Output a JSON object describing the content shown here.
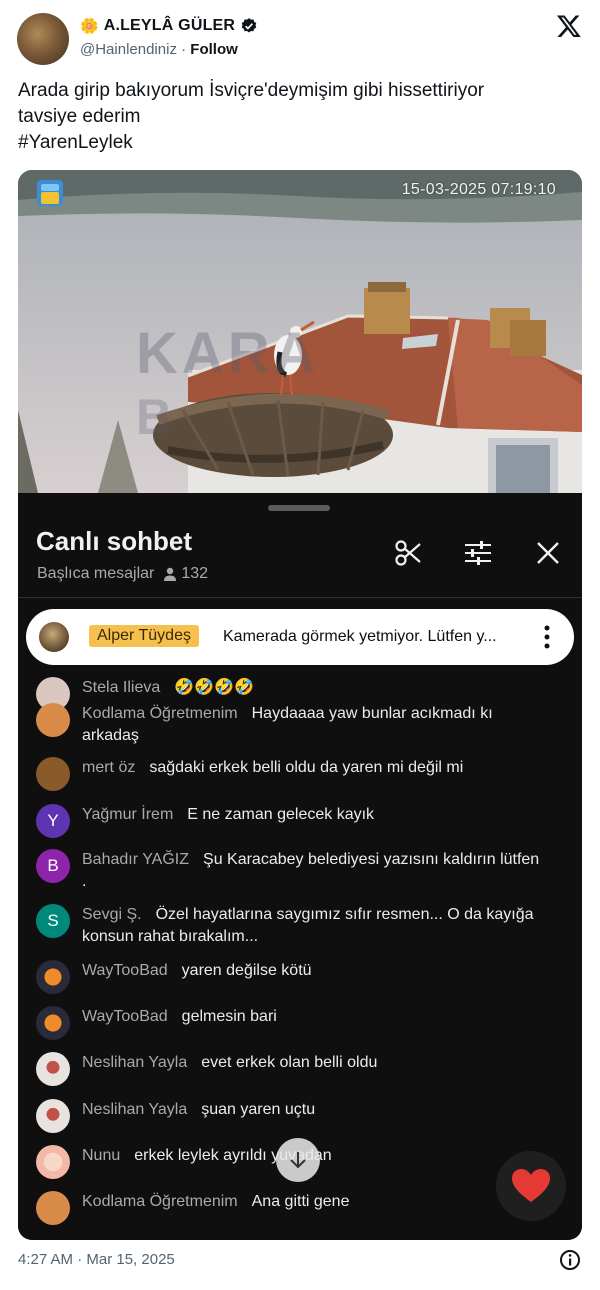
{
  "tweet": {
    "emoji": "🌼",
    "display_name": "A.LEYLÂ GÜLER",
    "handle": "@Hainlendiniz",
    "separator": " · ",
    "follow_label": "Follow",
    "text_lines": [
      "Arada girip bakıyorum İsviçre'deymişim gibi hissettiriyor",
      "tavsiye ederim",
      "#YarenLeylek"
    ],
    "footer": "4:27 AM · Mar 15, 2025"
  },
  "video": {
    "timestamp": "15-03-2025 07:19:10",
    "watermark_line1": "KARA",
    "watermark_line2": "B"
  },
  "chat": {
    "title": "Canlı sohbet",
    "filter_label": "Başlıca mesajlar",
    "viewer_count": "132",
    "pinned": {
      "author": "Alper Tüydeş",
      "message": "Kamerada görmek yetmiyor. Lütfen y..."
    },
    "messages": [
      {
        "author": "Stela Ilieva",
        "text": "🤣🤣🤣🤣",
        "avatar_letter": "",
        "avatar_color": "#d9c7c0"
      },
      {
        "author": "Kodlama Öğretmenim",
        "text": "Haydaaaa yaw bunlar acıkmadı kı arkadaş",
        "avatar_letter": "",
        "avatar_color": "#d98b4a"
      },
      {
        "author": "mert öz",
        "text": "sağdaki erkek belli oldu da yaren mi değil mi",
        "avatar_letter": "",
        "avatar_color": "#8a5a2a"
      },
      {
        "author": "Yağmur İrem",
        "text": "E ne zaman gelecek kayık",
        "avatar_letter": "Y",
        "avatar_color": "#5e35b1"
      },
      {
        "author": "Bahadır YAĞIZ",
        "text": "Şu Karacabey belediyesi yazısını kaldırın lütfen .",
        "avatar_letter": "B",
        "avatar_color": "#8e24aa"
      },
      {
        "author": "Sevgi Ş.",
        "text": "Özel hayatlarına saygımız sıfır resmen... O da kayığa konsun rahat bırakalım...",
        "avatar_letter": "S",
        "avatar_color": "#00897b"
      },
      {
        "author": "WayTooBad",
        "text": "yaren değilse kötü",
        "avatar_letter": "",
        "avatar_color": "#2a2a3a"
      },
      {
        "author": "WayTooBad",
        "text": "gelmesin bari",
        "avatar_letter": "",
        "avatar_color": "#2a2a3a"
      },
      {
        "author": "Neslihan Yayla",
        "text": "evet erkek olan belli oldu",
        "avatar_letter": "",
        "avatar_color": "#e9e3e0"
      },
      {
        "author": "Neslihan Yayla",
        "text": "şuan yaren uçtu",
        "avatar_letter": "",
        "avatar_color": "#e9e3e0"
      },
      {
        "author": "Nunu",
        "text": "erkek leylek ayrıldı yuvadan",
        "avatar_letter": "",
        "avatar_color": "#f4b8a8"
      },
      {
        "author": "Kodlama Öğretmenim",
        "text": "Ana gitti gene",
        "avatar_letter": "",
        "avatar_color": "#d98b4a"
      }
    ]
  },
  "colors": {
    "chat_bg": "#0f0f0f",
    "pinned_badge": "#f6c04e",
    "heart": "#e53935"
  }
}
